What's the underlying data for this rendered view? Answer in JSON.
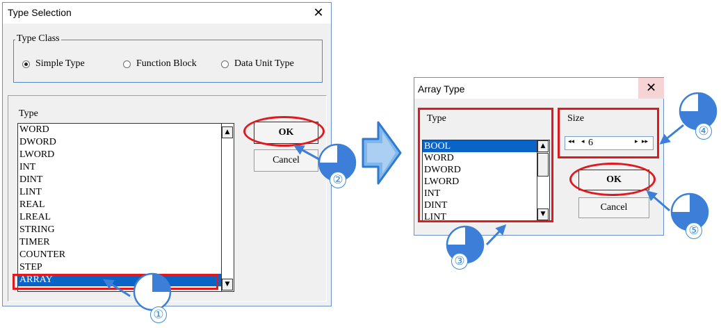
{
  "type_selection": {
    "title": "Type Selection",
    "close_glyph": "✕",
    "type_class": {
      "legend": "Type Class",
      "options": [
        {
          "label": "Simple Type",
          "selected": true
        },
        {
          "label": "Function Block",
          "selected": false
        },
        {
          "label": "Data Unit Type",
          "selected": false
        }
      ]
    },
    "type_label": "Type",
    "types": [
      "WORD",
      "DWORD",
      "LWORD",
      "INT",
      "DINT",
      "LINT",
      "REAL",
      "LREAL",
      "STRING",
      "TIMER",
      "COUNTER",
      "STEP",
      "ARRAY"
    ],
    "selected_type": "ARRAY",
    "ok_label": "OK",
    "cancel_label": "Cancel"
  },
  "array_type": {
    "title": "Array Type",
    "close_glyph": "✕",
    "type_label": "Type",
    "types": [
      "BOOL",
      "WORD",
      "DWORD",
      "LWORD",
      "INT",
      "DINT",
      "LINT"
    ],
    "selected_type": "BOOL",
    "size_label": "Size",
    "size_value": "6",
    "ok_label": "OK",
    "cancel_label": "Cancel"
  },
  "steps": [
    "①",
    "②",
    "③",
    "④",
    "⑤"
  ],
  "colors": {
    "highlight_red": "#e0191f",
    "annotation_blue": "#3b8cd0",
    "selection_blue": "#0a64c8",
    "arrow_blue": "#3d8fe0"
  }
}
